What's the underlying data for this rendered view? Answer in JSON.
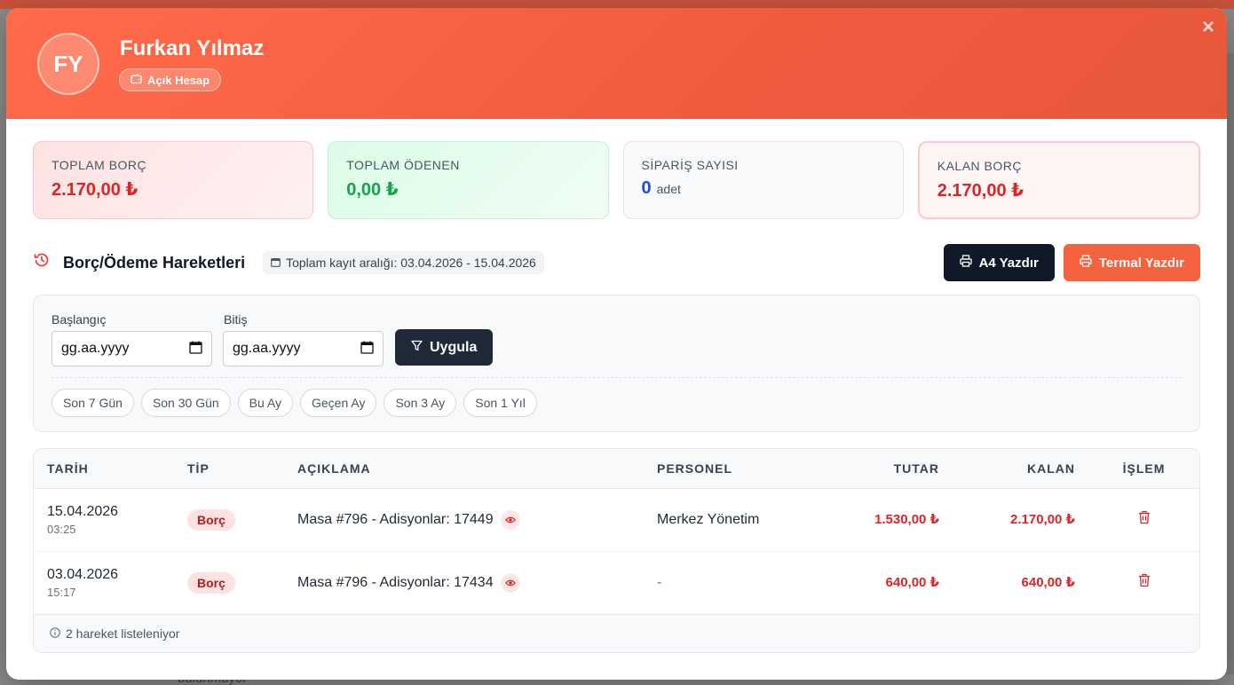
{
  "background": {
    "partial_text": "bulunmuyor"
  },
  "header": {
    "avatar_initials": "FY",
    "customer_name": "Furkan Yılmaz",
    "account_badge": "Açık Hesap",
    "close_label": "×",
    "gradient_color": "#ff6b4a"
  },
  "stats": {
    "total_debt": {
      "label": "TOPLAM BORÇ",
      "value": "2.170,00 ₺"
    },
    "total_paid": {
      "label": "TOPLAM ÖDENEN",
      "value": "0,00 ₺"
    },
    "order_count": {
      "label": "SİPARİŞ SAYISI",
      "value": "0",
      "unit": "adet"
    },
    "remaining_debt": {
      "label": "KALAN BORÇ",
      "value": "2.170,00 ₺"
    }
  },
  "section": {
    "title": "Borç/Ödeme Hareketleri",
    "range_text": "Toplam kayıt aralığı: 03.04.2026 - 15.04.2026",
    "print_a4": "A4 Yazdır",
    "print_thermal": "Termal Yazdır"
  },
  "filter": {
    "start_label": "Başlangıç",
    "start_placeholder": "gg.aa.yyyy",
    "end_label": "Bitiş",
    "end_placeholder": "gg.aa.yyyy",
    "apply_label": "Uygula",
    "presets": [
      "Son 7 Gün",
      "Son 30 Gün",
      "Bu Ay",
      "Geçen Ay",
      "Son 3 Ay",
      "Son 1 Yıl"
    ]
  },
  "table": {
    "headers": {
      "date": "TARİH",
      "type": "TİP",
      "description": "AÇIKLAMA",
      "staff": "PERSONEL",
      "amount": "TUTAR",
      "remaining": "KALAN",
      "action": "İŞLEM"
    },
    "rows": [
      {
        "date": "15.04.2026",
        "time": "03:25",
        "type": "Borç",
        "description": "Masa #796 - Adisyonlar: 17449",
        "staff": "Merkez Yönetim",
        "amount": "1.530,00 ₺",
        "remaining": "2.170,00 ₺"
      },
      {
        "date": "03.04.2026",
        "time": "15:17",
        "type": "Borç",
        "description": "Masa #796 - Adisyonlar: 17434",
        "staff": "-",
        "amount": "640,00 ₺",
        "remaining": "640,00 ₺"
      }
    ],
    "footer": "2 hareket listeleniyor"
  },
  "icons": {
    "wallet": "wallet-icon",
    "history": "history-icon",
    "calendar": "calendar-icon",
    "printer": "printer-icon",
    "filter": "filter-icon",
    "eye": "eye-icon",
    "trash": "trash-icon",
    "info": "info-icon"
  }
}
